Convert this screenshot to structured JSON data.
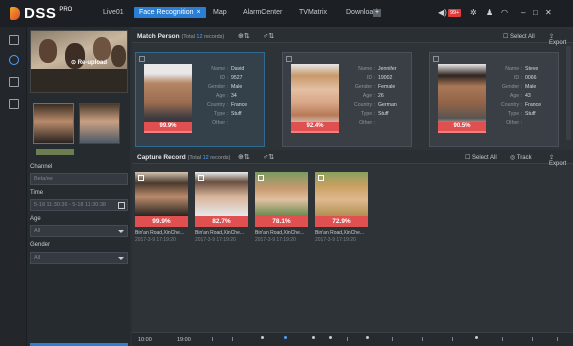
{
  "app": {
    "name": "DSS",
    "edition": "PRO"
  },
  "nav": {
    "tabs": [
      {
        "label": "Live01"
      },
      {
        "label": "Face Recognition"
      },
      {
        "label": "Map"
      },
      {
        "label": "AlarmCenter"
      },
      {
        "label": "TVMatrix"
      },
      {
        "label": "Download"
      }
    ],
    "active_close": "×",
    "add_label": "+"
  },
  "top_right": {
    "alarm_count": "99+"
  },
  "left_panel": {
    "reupload_label": "Re-upload",
    "channel_label": "Channel",
    "channel_value": "Beta/ee",
    "time_label": "Time",
    "time_value": "5-18 11:30:36 - 5-18 11:30:38",
    "age_label": "Age",
    "age_value": "All",
    "gender_label": "Gender",
    "gender_value": "All"
  },
  "match_section": {
    "title": "Match Person",
    "total_prefix": "(Total ",
    "total_count": "12",
    "total_suffix": " records)",
    "select_all": "Select All",
    "export": "Export"
  },
  "field_labels": {
    "name": "Name :",
    "id": "ID :",
    "gender": "Gender :",
    "age": "Age :",
    "country": "Country :",
    "type": "Type :",
    "other": "Other :"
  },
  "match_persons": [
    {
      "name": "David",
      "id": "9527",
      "gender": "Male",
      "age": "34",
      "country": "France",
      "type": "Stuff",
      "other": "",
      "score": "99.9%"
    },
    {
      "name": "Jennifer",
      "id": "19002",
      "gender": "Female",
      "age": "26",
      "country": "German",
      "type": "Stuff",
      "other": "",
      "score": "92.4%"
    },
    {
      "name": "Steve",
      "id": "0066",
      "gender": "Male",
      "age": "43",
      "country": "France",
      "type": "Stuff",
      "other": "",
      "score": "90.5%"
    }
  ],
  "capture_section": {
    "title": "Capture Record",
    "total_prefix": "(Total ",
    "total_count": "12",
    "total_suffix": " records)",
    "select_all": "Select All",
    "track": "Track",
    "export": "Export"
  },
  "captures": [
    {
      "score": "99.9%",
      "location": "Bin'an Road,XinChe...",
      "time": "2017-3-9 17:19:20"
    },
    {
      "score": "82.7%",
      "location": "Bin'an Road,XinChe...",
      "time": "2017-3-9 17:19:20"
    },
    {
      "score": "78.1%",
      "location": "Bin'an Road,XinChe...",
      "time": "2017-3-9 17:19:20"
    },
    {
      "score": "72.9%",
      "location": "Bin'an Road,XinChe...",
      "time": "2017-3-9 17:19:20"
    }
  ],
  "timeline": {
    "start": "10:00",
    "mid": "19:00"
  },
  "colors": {
    "accent": "#2a7fd4",
    "score": "#e05050",
    "bg": "#2e3338"
  }
}
